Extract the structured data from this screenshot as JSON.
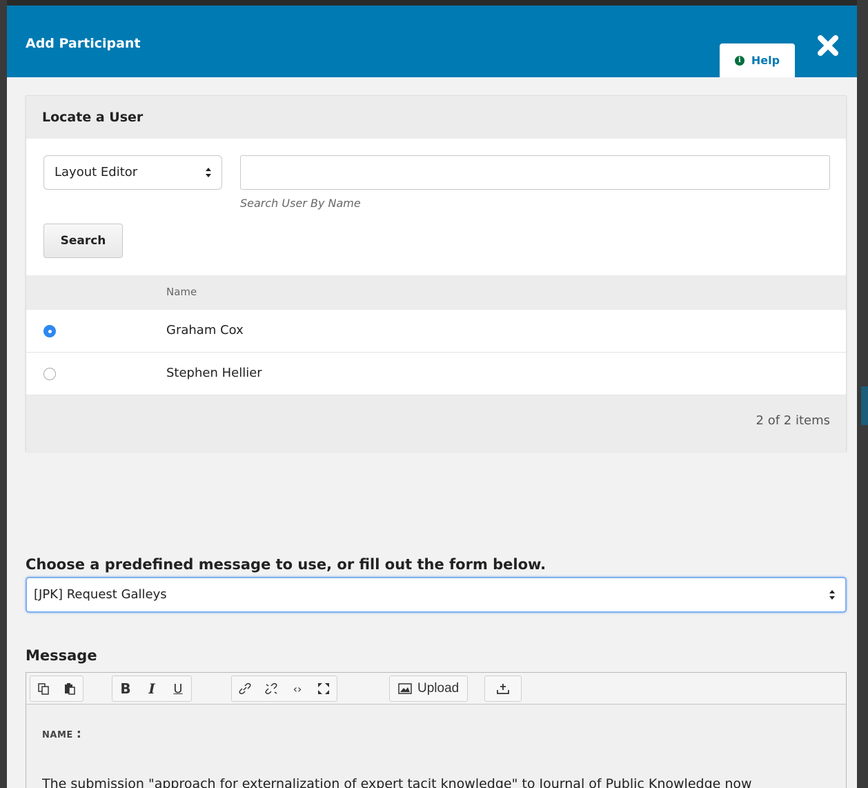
{
  "dialog": {
    "title": "Add Participant",
    "help_label": "Help"
  },
  "locate": {
    "title": "Locate a User",
    "role_select_value": "Layout Editor",
    "search_placeholder": "",
    "search_hint": "Search User By Name",
    "search_button": "Search",
    "column_name": "Name",
    "users": [
      {
        "name": "Graham Cox",
        "selected": true
      },
      {
        "name": "Stephen Hellier",
        "selected": false
      }
    ],
    "items_count": "2 of 2 items"
  },
  "predefined": {
    "label": "Choose a predefined message to use, or fill out the form below.",
    "selected": "[JPK] Request Galleys"
  },
  "message": {
    "label": "Message",
    "toolbar": {
      "upload_label": "Upload",
      "icons": [
        "copy-icon",
        "paste-icon",
        "bold-icon",
        "italic-icon",
        "underline-icon",
        "link-icon",
        "unlink-icon",
        "code-icon",
        "fullscreen-icon",
        "image-icon",
        "insert-icon"
      ]
    },
    "name_token": "NAME",
    "name_colon": ":",
    "body_line": "The submission \"approach for externalization of expert tacit knowledge\" to Journal of Public Knowledge now"
  },
  "colors": {
    "header": "#007ab2",
    "radio_selected": "#2e88f0",
    "help_icon": "#006f3c"
  }
}
